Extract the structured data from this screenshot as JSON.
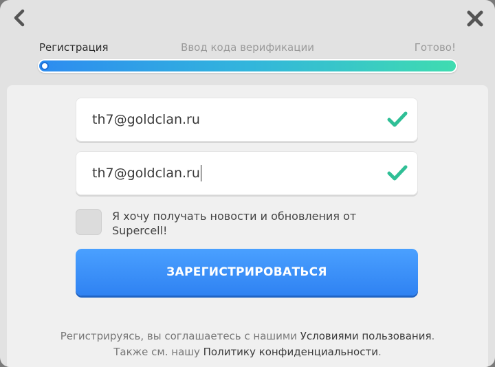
{
  "nav": {
    "back_icon": "chevron-left-icon",
    "close_icon": "close-icon"
  },
  "steps": [
    {
      "label": "Регистрация",
      "active": true
    },
    {
      "label": "Ввод кода верификации",
      "active": false
    },
    {
      "label": "Готово!",
      "active": false
    }
  ],
  "progress": {
    "value": 0.0,
    "colors": [
      "#2d8cf0",
      "#3fdcb0"
    ]
  },
  "form": {
    "email_value": "th7@goldclan.ru",
    "confirm_email_value": "th7@goldclan.ru",
    "valid_icon": "checkmark-icon",
    "valid_color": "#2fbf96",
    "newsletter_label": "Я хочу получать новости и обновления от Supercell!",
    "newsletter_checked": false,
    "register_label": "ЗАРЕГИСТРИРОВАТЬСЯ",
    "register_color": "#3a8ff8"
  },
  "legal": {
    "line1_prefix": "Регистрируясь, вы соглашаетесь с нашими ",
    "terms_link": "Условиями пользования",
    "line1_suffix": ".",
    "line2_prefix": "Также см. нашу ",
    "privacy_link": "Политику конфиденциальности",
    "line2_suffix": "."
  }
}
